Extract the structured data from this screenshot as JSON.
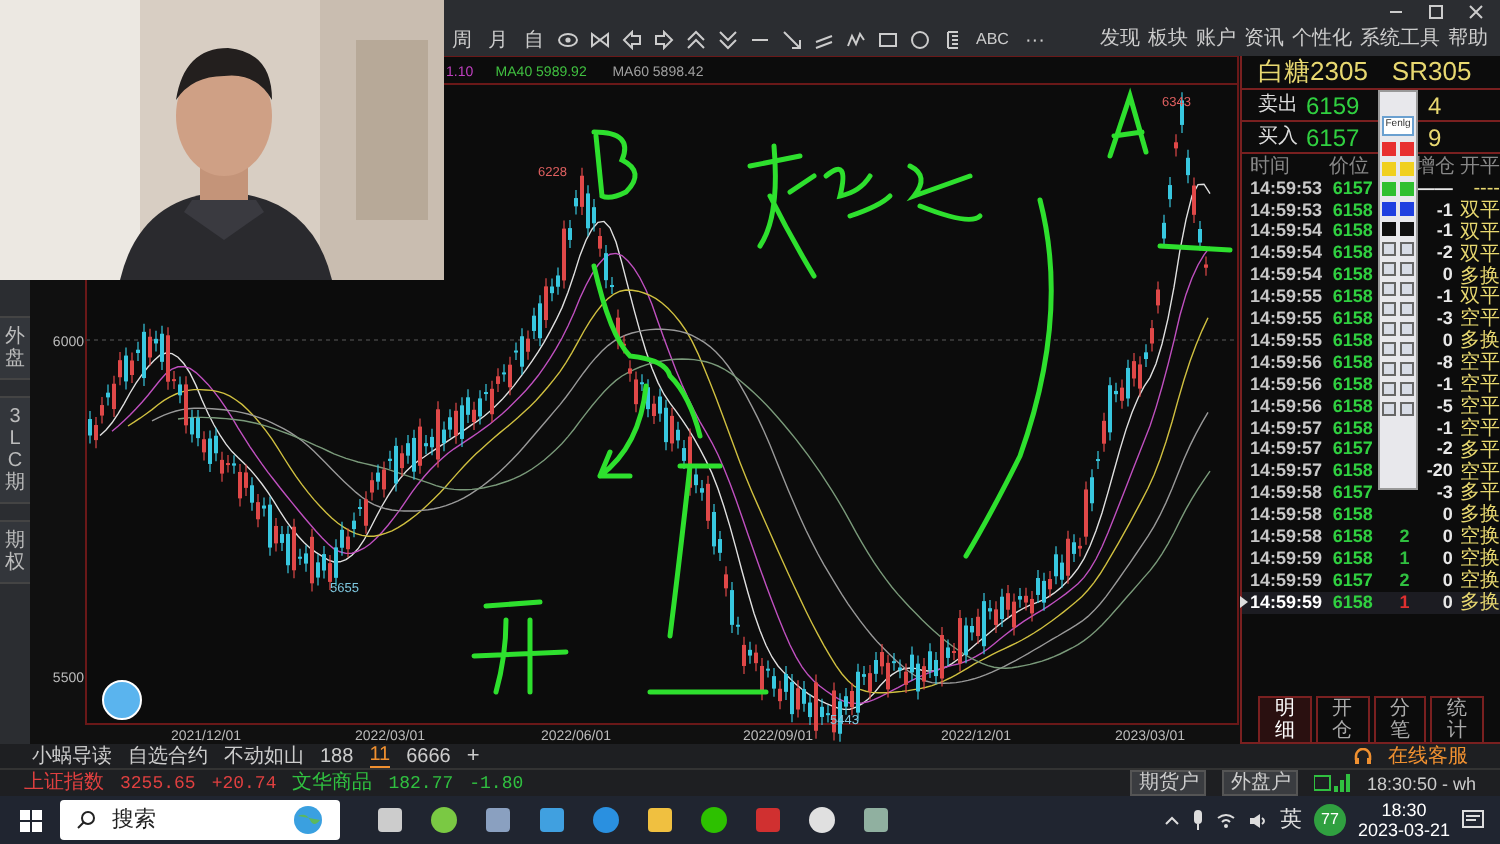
{
  "webcam": {
    "kind": "picture"
  },
  "toolbar": {
    "labels": [
      "周",
      "月",
      "自"
    ],
    "text_tool": "ABC",
    "more": "···"
  },
  "menu": [
    "发现",
    "板块",
    "账户",
    "资讯",
    "个性化",
    "系统工具",
    "帮助"
  ],
  "side_tabs": [
    "外盘",
    "3LC期",
    "期权"
  ],
  "chart": {
    "legend": [
      {
        "text": "1.10",
        "color": "#c040c0"
      },
      {
        "text": "MA40 5989.92",
        "color": "#40c040"
      },
      {
        "text": "MA60 5898.42",
        "color": "#a0a0a0"
      }
    ],
    "y_labels": [
      "6000",
      "5500"
    ],
    "x_labels": [
      "2021/12/01",
      "2022/03/01",
      "2022/06/01",
      "2022/09/01",
      "2022/12/01",
      "2023/03/01"
    ],
    "price_marks": [
      "6343",
      "6228",
      "5655",
      "5443"
    ]
  },
  "quote": {
    "name": "白糖2305",
    "code": "SR305",
    "sides": [
      {
        "label": "卖出",
        "price": "6159",
        "volume": "4"
      },
      {
        "label": "买入",
        "price": "6157",
        "volume": "9"
      }
    ]
  },
  "palette": {
    "label": "Fenlg"
  },
  "ticks": {
    "columns": [
      "时间",
      "价位",
      "增仓",
      "开平"
    ],
    "rows": [
      {
        "time": "14:59:53",
        "price": "6157",
        "oi": "——",
        "type": "----",
        "selected": false
      },
      {
        "time": "14:59:53",
        "price": "6158",
        "oi": "-1",
        "type": "双平",
        "selected": false
      },
      {
        "time": "14:59:54",
        "price": "6158",
        "oi": "-1",
        "type": "双平",
        "selected": false
      },
      {
        "time": "14:59:54",
        "price": "6158",
        "oi": "-2",
        "type": "双平",
        "selected": false
      },
      {
        "time": "14:59:54",
        "price": "6158",
        "oi": "0",
        "type": "多换",
        "selected": false
      },
      {
        "time": "14:59:55",
        "price": "6158",
        "oi": "-1",
        "type": "双平",
        "selected": false
      },
      {
        "time": "14:59:55",
        "price": "6158",
        "oi": "-3",
        "type": "空平",
        "selected": false
      },
      {
        "time": "14:59:55",
        "price": "6158",
        "oi": "0",
        "type": "多换",
        "selected": false
      },
      {
        "time": "14:59:56",
        "price": "6158",
        "oi": "-8",
        "type": "空平",
        "selected": false
      },
      {
        "time": "14:59:56",
        "price": "6158",
        "oi": "-1",
        "type": "空平",
        "selected": false
      },
      {
        "time": "14:59:56",
        "price": "6158",
        "oi": "-5",
        "type": "空平",
        "selected": false
      },
      {
        "time": "14:59:57",
        "price": "6158",
        "oi": "-1",
        "type": "空平",
        "selected": false
      },
      {
        "time": "14:59:57",
        "price": "6157",
        "oi": "-2",
        "type": "多平",
        "selected": false
      },
      {
        "time": "14:59:57",
        "price": "6158",
        "oi": "-20",
        "type": "空平",
        "selected": false
      },
      {
        "time": "14:59:58",
        "price": "6157",
        "oi": "-3",
        "type": "多平",
        "selected": false
      },
      {
        "time": "14:59:58",
        "price": "6158",
        "oi": "0",
        "type": "多换",
        "selected": false
      },
      {
        "time": "14:59:58",
        "price": "6158",
        "volume": "2",
        "color": "#30c040",
        "oi": "0",
        "type": "空换",
        "selected": false
      },
      {
        "time": "14:59:59",
        "price": "6158",
        "volume": "1",
        "color": "#30c040",
        "oi": "0",
        "type": "空换",
        "selected": false
      },
      {
        "time": "14:59:59",
        "price": "6157",
        "volume": "2",
        "color": "#30c040",
        "oi": "0",
        "type": "空换",
        "selected": false
      },
      {
        "time": "14:59:59",
        "price": "6158",
        "volume": "1",
        "color": "#e03030",
        "oi": "0",
        "type": "多换",
        "selected": true
      }
    ]
  },
  "panel_tabs": [
    {
      "label": "明细",
      "selected": true
    },
    {
      "label": "开仓",
      "selected": false
    },
    {
      "label": "分笔",
      "selected": false
    },
    {
      "label": "统计",
      "selected": false
    }
  ],
  "contract_tabs": [
    {
      "label": "小蜗导读",
      "selected": false
    },
    {
      "label": "自选合约",
      "selected": false
    },
    {
      "label": "不动如山",
      "selected": false
    },
    {
      "label": "188",
      "selected": false
    },
    {
      "label": "11",
      "selected": true
    },
    {
      "label": "6666",
      "selected": false
    }
  ],
  "add_tab": "+",
  "service": "在线客服",
  "status": {
    "indices": [
      {
        "name": "上证指数",
        "value": "3255.65",
        "change": "+20.74",
        "color": "#e04040"
      },
      {
        "name": "文华商品",
        "value": "182.77",
        "change": "-1.80",
        "color": "#30c040"
      }
    ],
    "buttons": [
      "期货户",
      "外盘户"
    ],
    "clock": "18:30:50 - wh"
  },
  "taskbar": {
    "search_placeholder": "搜索",
    "ime": "英",
    "badge": "77",
    "time": "18:30",
    "date": "2023-03-21"
  }
}
